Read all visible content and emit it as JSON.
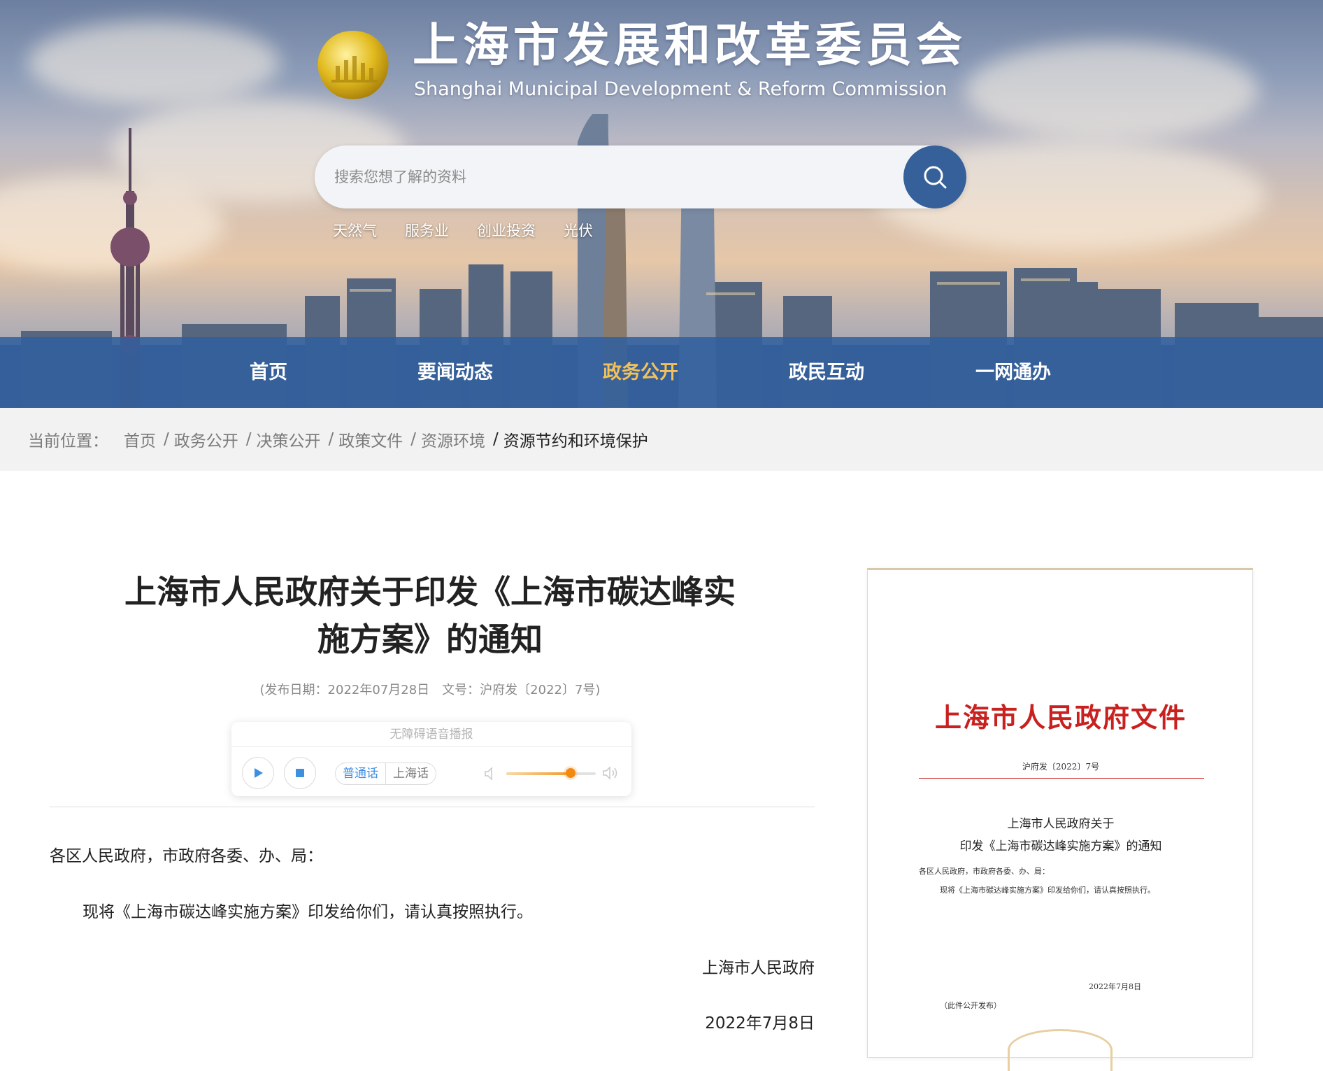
{
  "header": {
    "site_title": "上海市发展和改革委员会",
    "site_subtitle": "Shanghai Municipal Development & Reform Commission",
    "logo_icon": "gold-emblem-icon",
    "search": {
      "placeholder": "搜索您想了解的资料",
      "icon": "search-icon"
    },
    "hot_words": [
      "天然气",
      "服务业",
      "创业投资",
      "光伏"
    ],
    "colors": {
      "nav_bar": "#31609e",
      "nav_active": "#f3c15a",
      "search_button": "#36609a"
    }
  },
  "nav": {
    "items": [
      "首页",
      "要闻动态",
      "政务公开",
      "政民互动",
      "一网通办"
    ],
    "active": "政务公开"
  },
  "breadcrumb": {
    "prefix": "当前位置：",
    "items": [
      "首页",
      "政务公开",
      "决策公开",
      "政策文件",
      "资源环境"
    ],
    "current": "资源节约和环境保护"
  },
  "article": {
    "title_line1": "上海市人民政府关于印发《上海市碳达峰实",
    "title_line2": "施方案》的通知",
    "meta_date": "(发布日期：2022年07月28日",
    "meta_docno": "文号：沪府发〔2022〕7号)",
    "salutation": "各区人民政府，市政府各委、办、局：",
    "body": "现将《上海市碳达峰实施方案》印发给你们，请认真按照执行。",
    "signature": "上海市人民政府",
    "date": "2022年7月8日"
  },
  "player": {
    "title": "无障碍语音播报",
    "dialects": [
      "普通话",
      "上海话"
    ],
    "selected_dialect": "普通话",
    "volume_level": 0.72,
    "accent_color": "#3d8fe0"
  },
  "doc_preview": {
    "heading": "上海市人民政府文件",
    "doc_number": "沪府发〔2022〕7号",
    "title_line1": "上海市人民政府关于",
    "title_line2": "印发《上海市碳达峰实施方案》的通知",
    "salutation": "各区人民政府，市政府各委、办、局：",
    "body": "现将《上海市碳达峰实施方案》印发给你们，请认真按照执行。",
    "date": "2022年7月8日",
    "note": "（此件公开发布）",
    "heading_color": "#c8211f"
  }
}
